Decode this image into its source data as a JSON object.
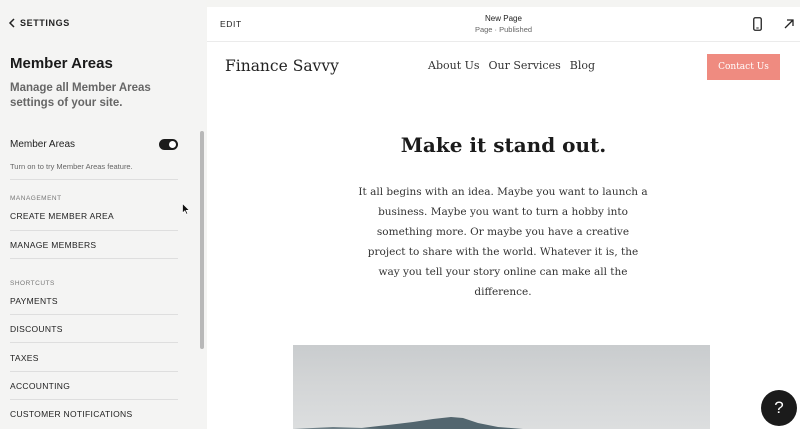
{
  "sidebar": {
    "back_label": "SETTINGS",
    "title": "Member Areas",
    "description": "Manage all Member Areas settings of your site.",
    "toggle": {
      "label": "Member Areas",
      "state": "on",
      "hint": "Turn on to try Member Areas feature."
    },
    "management": {
      "heading": "MANAGEMENT",
      "items": [
        "CREATE MEMBER AREA",
        "MANAGE MEMBERS"
      ]
    },
    "shortcuts": {
      "heading": "SHORTCUTS",
      "items": [
        "PAYMENTS",
        "DISCOUNTS",
        "TAXES",
        "ACCOUNTING",
        "CUSTOMER NOTIFICATIONS"
      ]
    }
  },
  "topbar": {
    "edit_label": "EDIT",
    "page_name": "New Page",
    "page_status": "Page · Published"
  },
  "site": {
    "logo": "Finance Savvy",
    "nav": [
      "About Us",
      "Our Services",
      "Blog"
    ],
    "cta_label": "Contact Us",
    "hero_title": "Make it stand out.",
    "hero_body": "It all begins with an idea. Maybe you want to launch a business. Maybe you want to turn a hobby into something more. Or maybe you have a creative project to share with the world. Whatever it is, the way you tell your story online can make all the difference."
  },
  "help": {
    "label": "?"
  },
  "colors": {
    "accent": "#ef8b80",
    "dark": "#1b1b1b",
    "sidebar_bg": "#f4f4f3"
  }
}
